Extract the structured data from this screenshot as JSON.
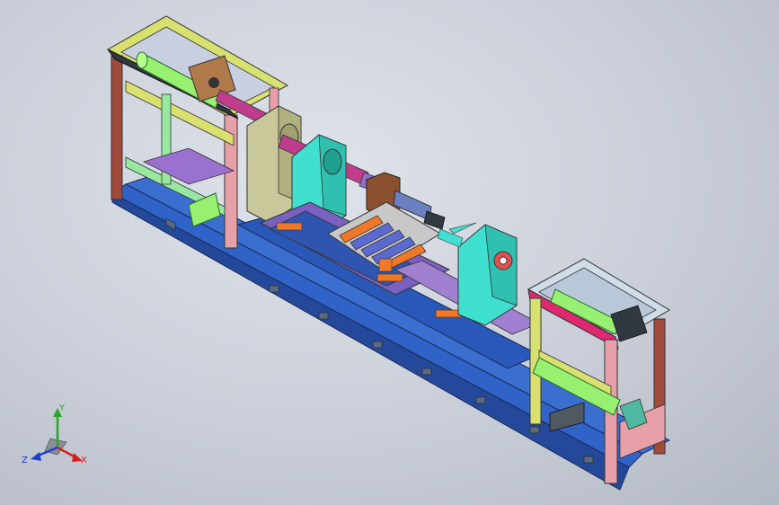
{
  "viewport": {
    "background": "#c9ced8"
  },
  "triad": {
    "x_label": "X",
    "y_label": "Y",
    "z_label": "Z",
    "x_color": "#d62020",
    "y_color": "#2aa52a",
    "z_color": "#2040d0"
  },
  "model": {
    "part_colors": {
      "base_blue": "#2f63c8",
      "frame_pink": "#e8a0a8",
      "frame_yellow": "#d8e070",
      "frame_brown": "#a04a3c",
      "cylinder_green": "#98f070",
      "support_cyan": "#40e0d0",
      "support_khaki": "#c8c89a",
      "roller_orange": "#f07828",
      "shaft_magenta": "#c03c8c",
      "plate_purple": "#7a60c0"
    }
  }
}
